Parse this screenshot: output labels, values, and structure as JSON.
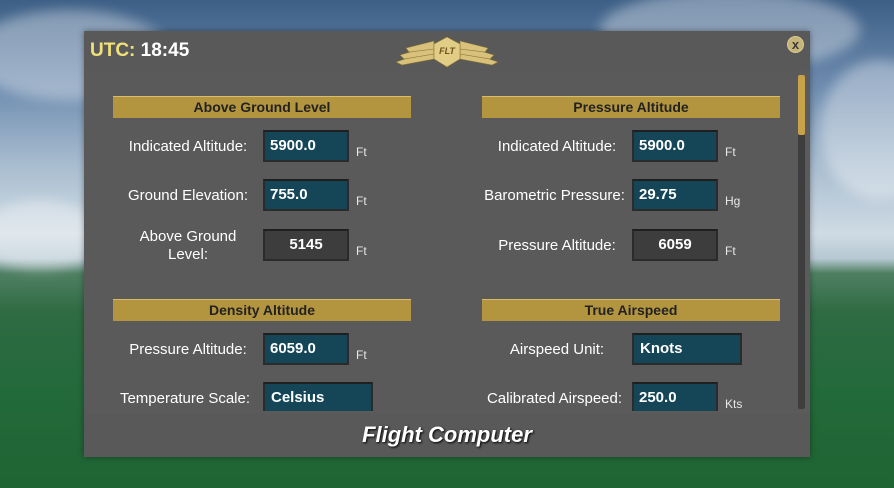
{
  "window": {
    "utc_label": "UTC:",
    "utc_time": "18:45",
    "logo_text": "FLT",
    "close_symbol": "x",
    "footer_title": "Flight Computer"
  },
  "sections": {
    "agl": {
      "title": "Above Ground Level",
      "indicated_altitude": {
        "label": "Indicated Altitude:",
        "value": "5900.0",
        "unit": "Ft"
      },
      "ground_elevation": {
        "label": "Ground Elevation:",
        "value": "755.0",
        "unit": "Ft"
      },
      "above_ground_level": {
        "label": "Above Ground Level:",
        "value": "5145",
        "unit": "Ft"
      }
    },
    "pressure_altitude": {
      "title": "Pressure Altitude",
      "indicated_altitude": {
        "label": "Indicated Altitude:",
        "value": "5900.0",
        "unit": "Ft"
      },
      "barometric_pressure": {
        "label": "Barometric Pressure:",
        "value": "29.75",
        "unit": "Hg"
      },
      "pressure_altitude": {
        "label": "Pressure Altitude:",
        "value": "6059",
        "unit": "Ft"
      }
    },
    "density_altitude": {
      "title": "Density Altitude",
      "pressure_altitude": {
        "label": "Pressure Altitude:",
        "value": "6059.0",
        "unit": "Ft"
      },
      "temperature_scale": {
        "label": "Temperature Scale:",
        "value": "Celsius"
      }
    },
    "true_airspeed": {
      "title": "True Airspeed",
      "airspeed_unit": {
        "label": "Airspeed Unit:",
        "value": "Knots"
      },
      "calibrated_airspeed": {
        "label": "Calibrated Airspeed:",
        "value": "250.0",
        "unit": "Kts"
      }
    }
  },
  "colors": {
    "accent_gold": "#b4953f",
    "input_bg": "#144658",
    "panel_bg": "#5b5b5b",
    "utc_label": "#f0e07a"
  }
}
